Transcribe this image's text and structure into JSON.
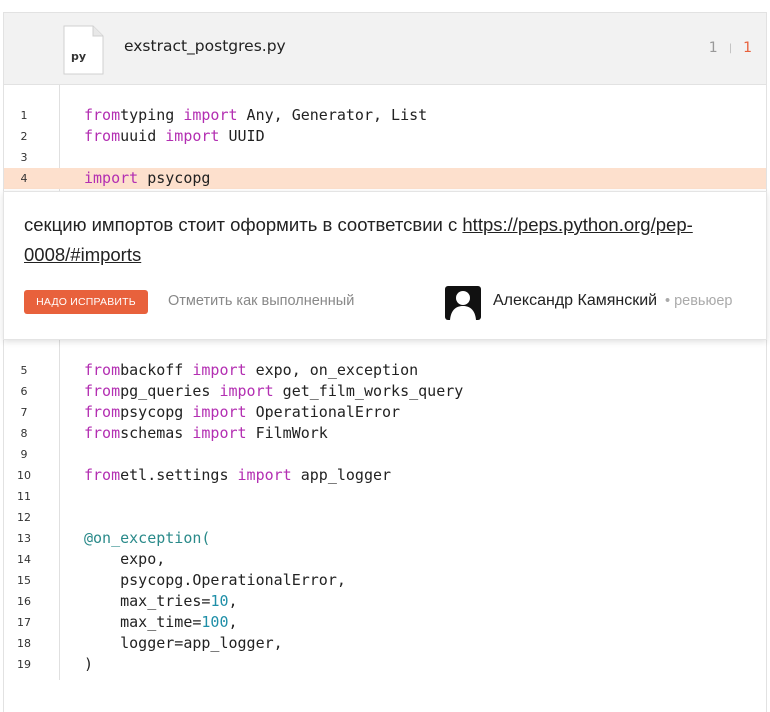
{
  "file": {
    "name": "exstract_postgres.py",
    "icon_label": "py",
    "count_total": "1",
    "count_separator": "|",
    "count_new": "1"
  },
  "code_top": [
    {
      "n": "1",
      "parts": [
        [
          "kw",
          "from"
        ],
        [
          "",
          "typing "
        ],
        [
          "kw",
          "import"
        ],
        [
          "",
          " Any, Generator, List"
        ]
      ]
    },
    {
      "n": "2",
      "parts": [
        [
          "kw",
          "from"
        ],
        [
          "",
          "uuid "
        ],
        [
          "kw",
          "import"
        ],
        [
          "",
          " UUID"
        ]
      ]
    },
    {
      "n": "3",
      "parts": []
    },
    {
      "n": "4",
      "hl": true,
      "parts": [
        [
          "kw",
          "import"
        ],
        [
          "",
          " psycopg"
        ]
      ]
    }
  ],
  "comment": {
    "text": "секцию импортов стоит оформить в соответсвии с ",
    "link": "https://peps.python.org/pep-0008/#imports",
    "fix_button": "НАДО ИСПРАВИТЬ",
    "mark_done": "Отметить как выполненный",
    "reviewer_name": "Александр Камянский",
    "reviewer_role": "• ревьюер"
  },
  "code_bottom": [
    {
      "n": "5",
      "parts": [
        [
          "kw",
          "from"
        ],
        [
          "",
          "backoff "
        ],
        [
          "kw",
          "import"
        ],
        [
          "",
          " expo, on_exception"
        ]
      ]
    },
    {
      "n": "6",
      "parts": [
        [
          "kw",
          "from"
        ],
        [
          "",
          "pg_queries "
        ],
        [
          "kw",
          "import"
        ],
        [
          "",
          " get_film_works_query"
        ]
      ]
    },
    {
      "n": "7",
      "parts": [
        [
          "kw",
          "from"
        ],
        [
          "",
          "psycopg "
        ],
        [
          "kw",
          "import"
        ],
        [
          "",
          " OperationalError"
        ]
      ]
    },
    {
      "n": "8",
      "parts": [
        [
          "kw",
          "from"
        ],
        [
          "",
          "schemas "
        ],
        [
          "kw",
          "import"
        ],
        [
          "",
          " FilmWork"
        ]
      ]
    },
    {
      "n": "9",
      "parts": []
    },
    {
      "n": "10",
      "parts": [
        [
          "kw",
          "from"
        ],
        [
          "",
          "etl.settings "
        ],
        [
          "kw",
          "import"
        ],
        [
          "",
          " app_logger"
        ]
      ]
    },
    {
      "n": "11",
      "parts": []
    },
    {
      "n": "12",
      "parts": []
    },
    {
      "n": "13",
      "parts": [
        [
          "dec",
          "@on_exception("
        ]
      ]
    },
    {
      "n": "14",
      "parts": [
        [
          "",
          "    expo,"
        ]
      ]
    },
    {
      "n": "15",
      "parts": [
        [
          "",
          "    psycopg.OperationalError,"
        ]
      ]
    },
    {
      "n": "16",
      "parts": [
        [
          "",
          "    max_tries="
        ],
        [
          "num",
          "10"
        ],
        [
          "",
          ","
        ]
      ]
    },
    {
      "n": "17",
      "parts": [
        [
          "",
          "    max_time="
        ],
        [
          "num",
          "100"
        ],
        [
          "",
          ","
        ]
      ]
    },
    {
      "n": "18",
      "parts": [
        [
          "",
          "    logger=app_logger,"
        ]
      ]
    },
    {
      "n": "19",
      "parts": [
        [
          "",
          ")"
        ]
      ]
    }
  ]
}
